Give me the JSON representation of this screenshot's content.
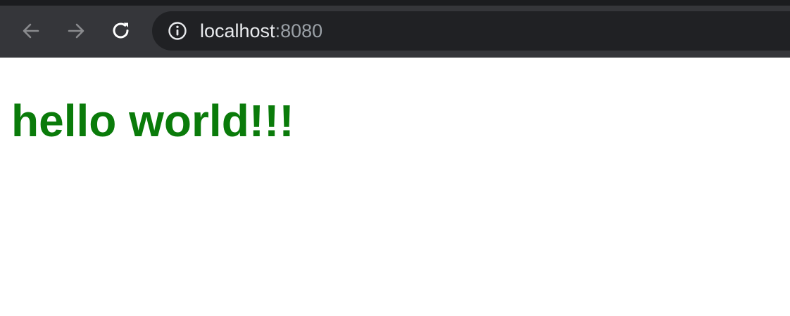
{
  "browser": {
    "url": {
      "host": "localhost",
      "port": ":8080"
    },
    "icons": {
      "back": "arrow-left-icon",
      "forward": "arrow-right-icon",
      "reload": "reload-icon",
      "site_info": "info-icon"
    },
    "colors": {
      "toolbar": "#35363a",
      "omnibox": "#202124"
    }
  },
  "page": {
    "heading": "hello world!!!",
    "heading_color": "#0a7b0a"
  }
}
